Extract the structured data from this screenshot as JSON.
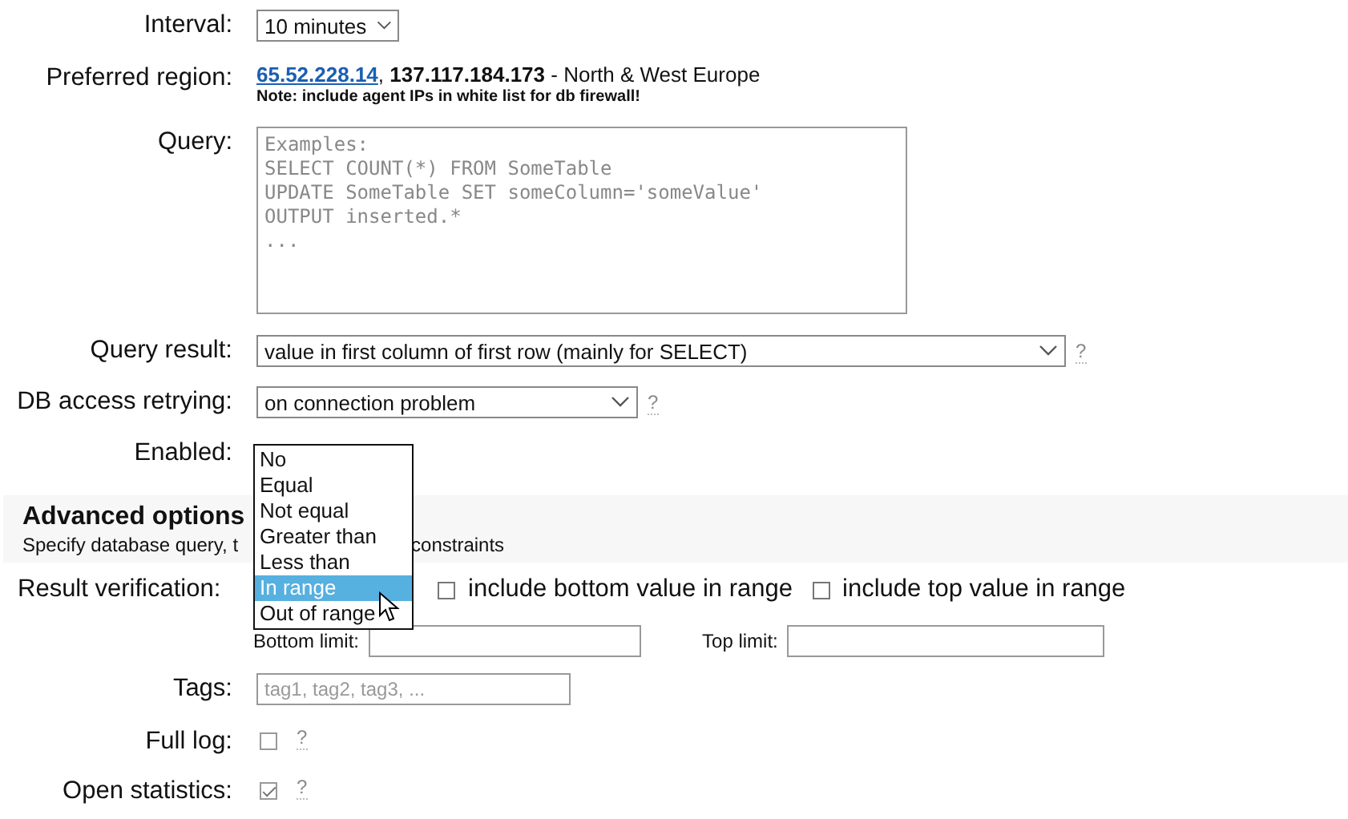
{
  "rows_top": [
    {
      "kind": "select",
      "label": "Interval:",
      "value": "10 minutes"
    },
    {
      "kind": "region",
      "label": "Preferred region:",
      "link": "65.52.228.14",
      "separator": ",",
      "ips": "137.117.184.173",
      "suffix": "- North & West Europe",
      "note": "Note: include agent IPs in white list for db firewall!"
    },
    {
      "kind": "textarea",
      "label": "Query:",
      "placeholder": "Examples:\nSELECT COUNT(*) FROM SomeTable\nUPDATE SomeTable SET someColumn='someValue'\nOUTPUT inserted.*\n..."
    },
    {
      "kind": "select",
      "label": "Query result:",
      "value": "value in first column of first row (mainly for SELECT)",
      "help_text": "?"
    },
    {
      "kind": "select",
      "label": "DB access retrying:",
      "value": "on connection problem",
      "help_text": "?"
    },
    {
      "kind": "label",
      "label": "Enabled:"
    }
  ],
  "advanced": {
    "title": "Advanced options",
    "description_start": "Specify database query, t",
    "description_end": "constraints"
  },
  "verification": {
    "label": "Result verification:",
    "include_bottom": {
      "label": "include bottom value in range",
      "checked": false
    },
    "include_top": {
      "label": "include top value in range",
      "checked": false
    },
    "bottom_label": "Bottom limit:",
    "top_label": "Top limit:"
  },
  "rows_bottom": [
    {
      "kind": "input",
      "label": "Tags:",
      "placeholder": "tag1, tag2, tag3, ..."
    },
    {
      "kind": "checkbox",
      "label": "Full log:",
      "checked": false,
      "help_text": "?"
    },
    {
      "kind": "checkbox",
      "label": "Open statistics:",
      "checked": true,
      "help_text": "?"
    }
  ],
  "dropdown": {
    "options": [
      {
        "label": "No",
        "selected": false
      },
      {
        "label": "Equal",
        "selected": false
      },
      {
        "label": "Not equal",
        "selected": false
      },
      {
        "label": "Greater than",
        "selected": false
      },
      {
        "label": "Less than",
        "selected": false
      },
      {
        "label": "In range",
        "selected": true
      },
      {
        "label": "Out of range",
        "selected": false
      }
    ]
  }
}
